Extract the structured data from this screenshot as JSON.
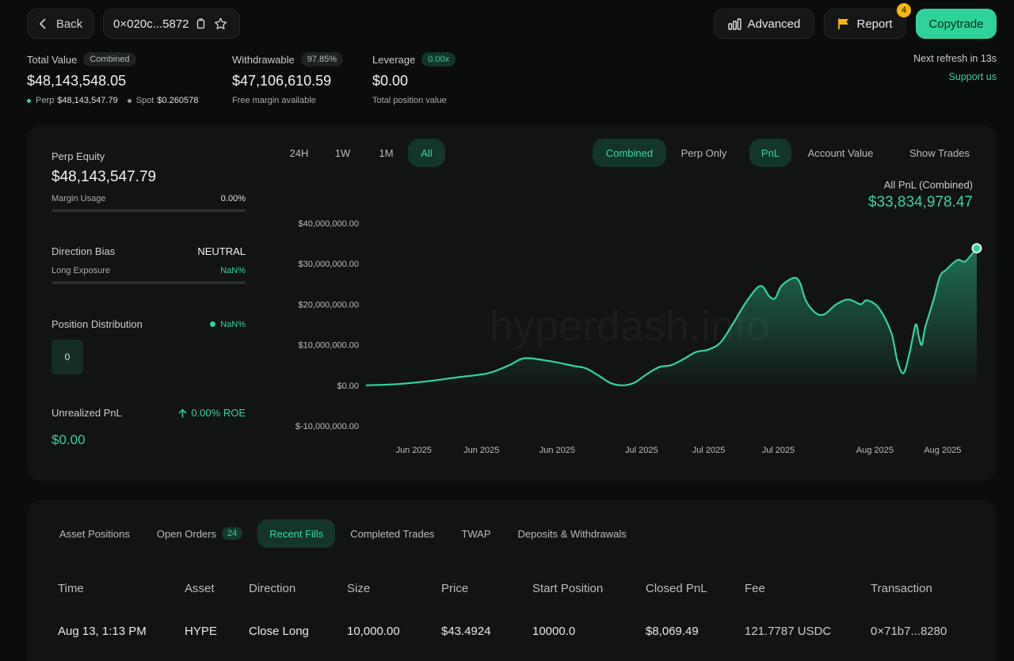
{
  "header": {
    "back_label": "Back",
    "address": "0×020c...5872",
    "advanced_label": "Advanced",
    "report_label": "Report",
    "report_badge": "4",
    "copytrade_label": "Copytrade",
    "next_refresh": "Next refresh in 13s",
    "support_label": "Support us"
  },
  "summary": {
    "total_value_label": "Total Value",
    "total_value_tag": "Combined",
    "total_value": "$48,143,548.05",
    "perp_label": "Perp",
    "perp_value": "$48,143,547.79",
    "spot_label": "Spot",
    "spot_value": "$0.260578",
    "withdrawable_label": "Withdrawable",
    "withdrawable_tag": "97.85%",
    "withdrawable_value": "$47,106,610.59",
    "withdrawable_sub": "Free margin available",
    "leverage_label": "Leverage",
    "leverage_tag": "0.00x",
    "leverage_value": "$0.00",
    "leverage_sub": "Total position value"
  },
  "left_panel": {
    "perp_equity_label": "Perp Equity",
    "perp_equity_value": "$48,143,547.79",
    "margin_usage_label": "Margin Usage",
    "margin_usage_value": "0.00%",
    "direction_bias_label": "Direction Bias",
    "direction_bias_value": "NEUTRAL",
    "long_exposure_label": "Long Exposure",
    "long_exposure_value": "NaN%",
    "position_dist_label": "Position Distribution",
    "position_dist_value": "NaN%",
    "position_count": "0",
    "unrealized_pnl_label": "Unrealized PnL",
    "roe_value": "0.00% ROE",
    "unrealized_pnl_value": "$0.00"
  },
  "chart_controls": {
    "ranges": [
      "24H",
      "1W",
      "1M",
      "All"
    ],
    "active_range": "All",
    "views": [
      "Combined",
      "Perp Only"
    ],
    "active_view": "Combined",
    "metrics": [
      "PnL",
      "Account Value"
    ],
    "active_metric": "PnL",
    "show_trades_label": "Show Trades",
    "pnl_title": "All PnL (Combined)",
    "pnl_value": "$33,834,978.47",
    "watermark": "hyperdash.info"
  },
  "chart_data": {
    "type": "area",
    "title": "",
    "xlabel": "",
    "ylabel": "",
    "ylim": [
      -10000000,
      40000000
    ],
    "ytick_labels": [
      "$40,000,000.00",
      "$30,000,000.00",
      "$20,000,000.00",
      "$10,000,000.00",
      "$0.00",
      "$-10,000,000.00"
    ],
    "yticks": [
      40000000,
      30000000,
      20000000,
      10000000,
      0,
      -10000000
    ],
    "xtick_labels": [
      "Jun 2025",
      "Jun 2025",
      "Jun 2025",
      "Jul 2025",
      "Jul 2025",
      "Jul 2025",
      "Aug 2025",
      "Aug 2025"
    ],
    "xtick_positions": [
      0.117,
      0.228,
      0.352,
      0.49,
      0.6,
      0.714,
      0.872,
      0.983
    ],
    "grid": false,
    "color": "#35d39b",
    "series": [
      {
        "x": [
          0,
          0.05,
          0.1,
          0.15,
          0.2,
          0.235,
          0.26,
          0.3,
          0.34,
          0.36,
          0.38,
          0.4,
          0.42,
          0.44,
          0.46,
          0.48,
          0.5,
          0.52,
          0.54,
          0.56,
          0.58,
          0.6,
          0.62,
          0.64,
          0.65,
          0.66,
          0.67,
          0.68,
          0.7,
          0.71,
          0.72,
          0.735,
          0.75,
          0.77,
          0.79,
          0.81,
          0.82,
          0.84,
          0.86,
          0.87,
          0.88,
          0.89,
          0.9,
          0.905,
          0.91,
          0.915,
          0.92,
          0.93,
          0.94,
          0.95,
          0.96,
          0.97,
          0.98,
          0.99,
          1.0
        ],
        "values": [
          0,
          300000,
          1000000,
          2000000,
          3000000,
          5000000,
          6700000,
          6000000,
          4800000,
          4200000,
          2500000,
          600000,
          0,
          700000,
          2800000,
          4500000,
          5000000,
          6500000,
          8200000,
          8800000,
          10500000,
          15000000,
          20000000,
          24000000,
          24300000,
          22000000,
          21500000,
          24500000,
          26500000,
          25500000,
          21000000,
          18000000,
          17500000,
          20000000,
          21200000,
          20000000,
          21000000,
          19000000,
          13000000,
          6000000,
          3000000,
          8000000,
          15000000,
          12000000,
          10000000,
          14000000,
          16500000,
          21500000,
          27000000,
          28500000,
          30000000,
          31000000,
          30500000,
          32000000,
          33834978.47
        ]
      }
    ]
  },
  "tabs": [
    {
      "label": "Asset Positions",
      "badge": ""
    },
    {
      "label": "Open Orders",
      "badge": "24"
    },
    {
      "label": "Recent Fills",
      "badge": ""
    },
    {
      "label": "Completed Trades",
      "badge": ""
    },
    {
      "label": "TWAP",
      "badge": ""
    },
    {
      "label": "Deposits & Withdrawals",
      "badge": ""
    }
  ],
  "active_tab": "Recent Fills",
  "table": {
    "columns": [
      "Time",
      "Asset",
      "Direction",
      "Size",
      "Price",
      "Start Position",
      "Closed PnL",
      "Fee",
      "Transaction"
    ],
    "rows": [
      [
        "Aug 13, 1:13 PM",
        "HYPE",
        "Close Long",
        "10,000.00",
        "$43.4924",
        "10000.0",
        "$8,069.49",
        "121.7787 USDC",
        "0×71b7...8280"
      ]
    ]
  },
  "colors": {
    "accent": "#35d39b",
    "background": "#0b0c0c",
    "panel": "#121414",
    "badge": "#f2b90c"
  }
}
